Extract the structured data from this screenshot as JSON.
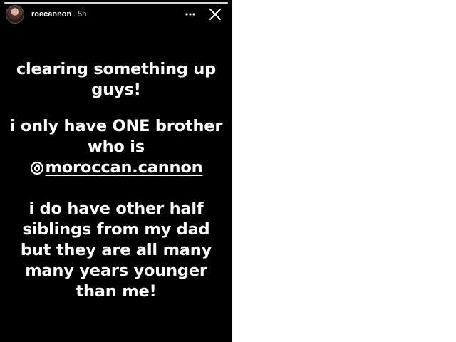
{
  "story": {
    "progress": 1.0,
    "user": {
      "username": "roecannon",
      "time_ago": "5h"
    },
    "paragraph_1": {
      "line_1": "clearing something up",
      "line_2": "guys!"
    },
    "paragraph_2": {
      "line_1": "i only have ONE brother",
      "line_2": "who is",
      "mention": "moroccan.cannon"
    },
    "paragraph_3": {
      "line_1": "i do have other half",
      "line_2": "siblings from my dad",
      "line_3": "but they are all many",
      "line_4": "many years younger",
      "line_5": "than me!"
    }
  },
  "icons": {
    "more": "more-horizontal-icon",
    "close": "close-icon",
    "mention": "threads-icon"
  },
  "colors": {
    "background": "#000000",
    "text": "#ffffff",
    "muted": "#a8a8a8"
  }
}
